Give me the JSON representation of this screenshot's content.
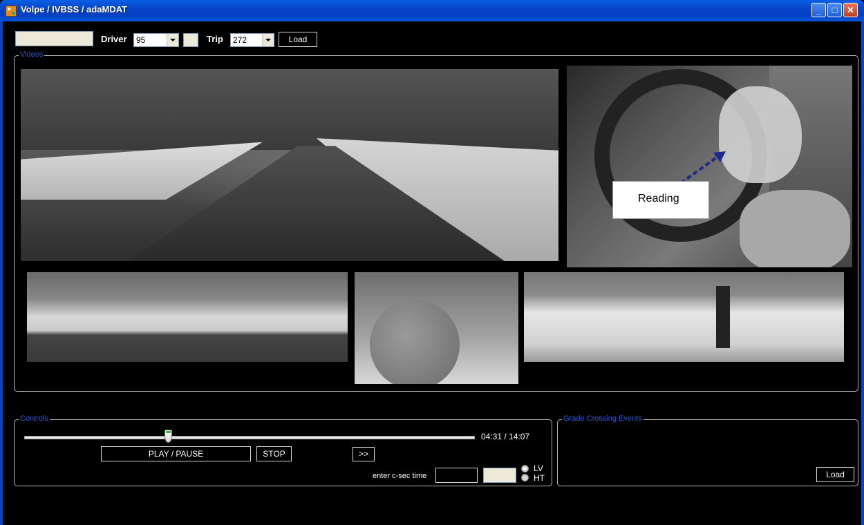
{
  "window": {
    "title": "Volpe / IVBSS / adaMDAT",
    "minimize_glyph": "_",
    "maximize_glyph": "□",
    "close_glyph": "✕"
  },
  "toolbar": {
    "driver_label": "Driver",
    "driver_value": "95",
    "trip_label": "Trip",
    "trip_value": "272",
    "load_label": "Load"
  },
  "videos": {
    "group_label": "Videos",
    "overlay_text": "Reading"
  },
  "controls": {
    "group_label": "Controls",
    "progress_fraction": 0.32,
    "time_readout": "04:31 / 14:07",
    "play_pause_label": "PLAY / PAUSE",
    "stop_label": "STOP",
    "forward_label": ">>",
    "csec_label": "enter c-sec time",
    "radio_lv_label": "LV",
    "radio_ht_label": "HT"
  },
  "events": {
    "group_label": "Grade Crossing Events",
    "load_label": "Load"
  },
  "colors": {
    "titlebar": "#0645c9",
    "group_label": "#2a5ad9",
    "overlay_arrow": "#1c2a8f"
  }
}
